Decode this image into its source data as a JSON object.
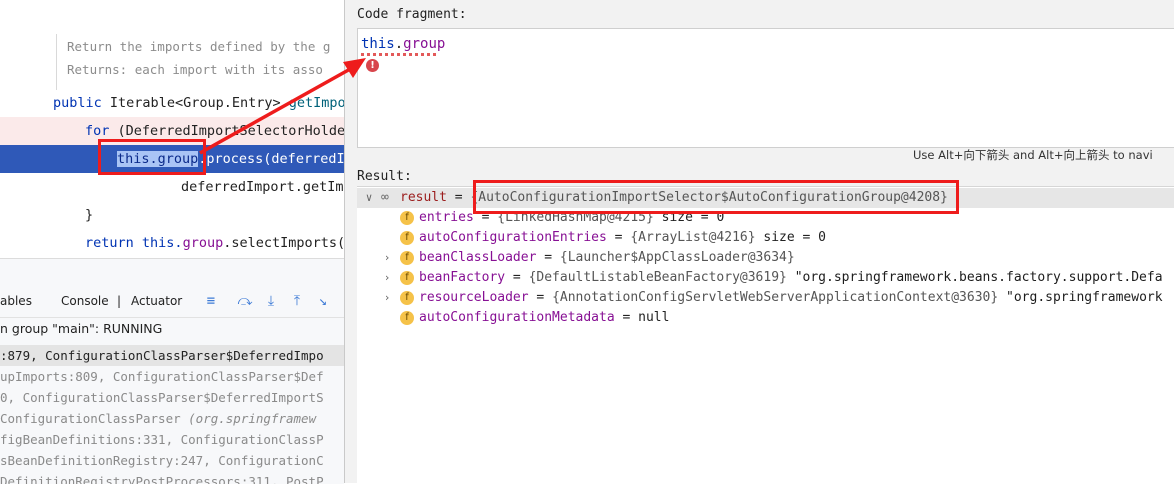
{
  "editor": {
    "doc_line1": "Return the imports defined by the g",
    "doc_line2_keyword": "Returns:",
    "doc_line2_text": "each import with its asso",
    "method_modifier": "public",
    "method_rtype": "Iterable<Group.Entry>",
    "method_name": "getImpo",
    "for_kw": "for",
    "for_rest": "(DeferredImportSelectorHolder",
    "call_this": "this.group",
    "call_rest": ".process(deferredIm",
    "arg_line": "deferredImport.getImp",
    "close_brace": "}",
    "return_kw": "return",
    "return_this": "this.",
    "return_field": "group",
    "return_rest": ".selectImports()"
  },
  "debugger": {
    "tab_variables": "ables",
    "tab_console": "Console",
    "tab_separator": "|",
    "tab_actuator": "Actuator",
    "toolbar_icons": [
      "menu-icon",
      "step-over-icon",
      "step-into-icon",
      "step-out-icon",
      "run-to-cursor-icon"
    ],
    "thread_status": "n group \"main\": RUNNING",
    "frames": [
      {
        "text": ":879, ConfigurationClassParser$DeferredImpo",
        "italic": ""
      },
      {
        "text": "upImports:809, ConfigurationClassParser$Def",
        "italic": ""
      },
      {
        "text": "0, ConfigurationClassParser$DeferredImportS",
        "italic": ""
      },
      {
        "text": " ConfigurationClassParser ",
        "italic": "(org.springframew"
      },
      {
        "text": "figBeanDefinitions:331, ConfigurationClassP",
        "italic": ""
      },
      {
        "text": "sBeanDefinitionRegistry:247, ConfigurationC",
        "italic": ""
      },
      {
        "text": "DefinitionRegistryPostProcessors:311, PostP",
        "italic": ""
      }
    ]
  },
  "dialog": {
    "code_fragment_label": "Code fragment:",
    "expression_this": "this",
    "expression_dot": ".",
    "expression_field": "group",
    "hint": "Use Alt+向下箭头 and Alt+向上箭头 to navi",
    "result_label": "Result:",
    "result": {
      "name": "result",
      "value": "{AutoConfigurationImportSelector$AutoConfigurationGroup@4208}"
    },
    "fields": [
      {
        "name": "entries",
        "value": "{LinkedHashMap@4215}",
        "extra": " size = 0",
        "expandable": false
      },
      {
        "name": "autoConfigurationEntries",
        "value": "{ArrayList@4216}",
        "extra": " size = 0",
        "expandable": false
      },
      {
        "name": "beanClassLoader",
        "value": "{Launcher$AppClassLoader@3634}",
        "extra": "",
        "expandable": true
      },
      {
        "name": "beanFactory",
        "value": "{DefaultListableBeanFactory@3619}",
        "extra": "\"org.springframework.beans.factory.support.Defa",
        "expandable": true
      },
      {
        "name": "resourceLoader",
        "value": "{AnnotationConfigServletWebServerApplicationContext@3630}",
        "extra": "\"org.springframework",
        "expandable": true
      },
      {
        "name": "autoConfigurationMetadata",
        "value": "null",
        "extra": "",
        "expandable": false
      }
    ]
  },
  "colors": {
    "annotation_red": "#ee1c1c",
    "keyword_blue": "#0033b3",
    "field_purple": "#871094",
    "selected_line_blue": "#2f59b8"
  }
}
